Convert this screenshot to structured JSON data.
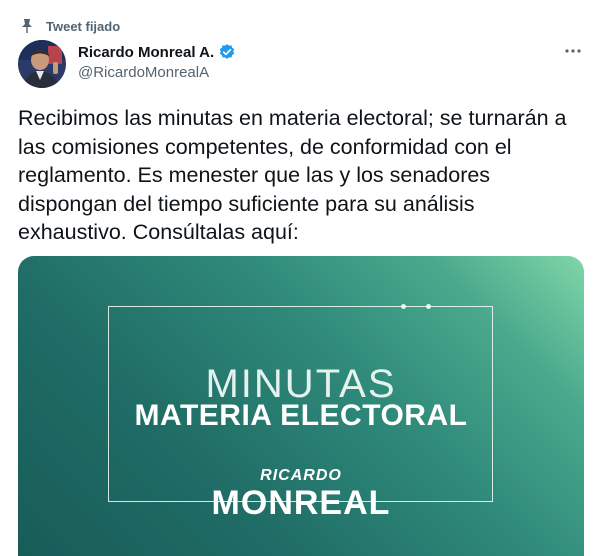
{
  "pinned": {
    "label": "Tweet fijado",
    "icon": "pin-icon"
  },
  "author": {
    "display_name": "Ricardo Monreal A.",
    "handle": "@RicardoMonrealA",
    "verified_icon": "verified-badge-icon",
    "avatar": "avatar"
  },
  "more_menu": {
    "icon": "more-options-icon"
  },
  "tweet": {
    "text": "Recibimos las minutas en materia electoral; se turnarán a las comisiones competentes, de conformidad con el reglamento. Es menester que las y los senadores dispongan del tiempo suficiente para su análisis exhaustivo. Consúltalas aquí:"
  },
  "media": {
    "line1": "MINUTAS",
    "line2": "MATERIA ELECTORAL",
    "brand_top": "RICARDO",
    "brand_bottom": "MONREAL",
    "colors": {
      "gradient_light": "#7fd6a8",
      "gradient_dark": "#185c58"
    }
  },
  "colors": {
    "verified": "#1d9bf0",
    "secondary_text": "#536471",
    "primary_text": "#0f1419"
  }
}
